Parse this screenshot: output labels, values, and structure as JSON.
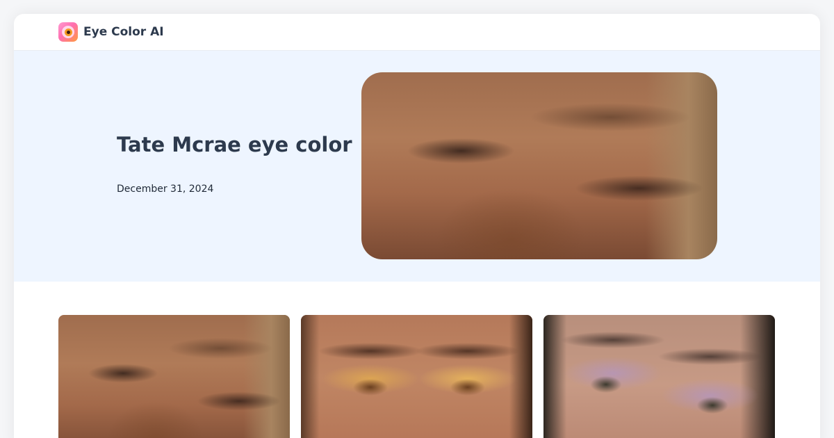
{
  "header": {
    "brand": "Eye Color AI",
    "logo_icon": "eye-logo-icon"
  },
  "hero": {
    "title": "Tate Mcrae eye color",
    "date": "December 31, 2024",
    "image_alt": "Close-up of Tate McRae's eyes with winged eyeliner"
  },
  "gallery": {
    "items": [
      {
        "alt": "Tate McRae eyes close-up, one eye squinting"
      },
      {
        "alt": "Tate McRae eyes with gold eyeshadow and brown irises"
      },
      {
        "alt": "Tate McRae eyes with lilac eyeshadow"
      }
    ]
  },
  "colors": {
    "hero_background": "#eef5ff",
    "title_text": "#2d3a4d",
    "card_background": "#ffffff"
  }
}
